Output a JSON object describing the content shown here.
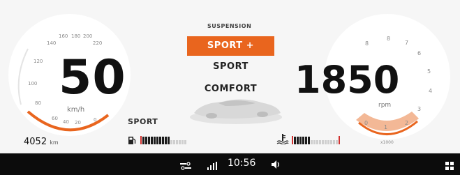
{
  "speedometer": {
    "value": "50",
    "unit": "km/h",
    "scale_top": [
      "160",
      "180",
      "200"
    ],
    "scale_top_small": [
      "140",
      "220"
    ],
    "scale_left": [
      "120",
      "100",
      "80"
    ],
    "scale_bottom": [
      "60",
      "40",
      "20",
      "0"
    ]
  },
  "odometer": {
    "value": "4052",
    "unit": "km"
  },
  "drive_mode": "SPORT",
  "suspension": {
    "title": "SUSPENSION",
    "options": [
      "SPORT +",
      "SPORT",
      "COMFORT"
    ],
    "selected_index": 0
  },
  "tachometer": {
    "value": "1850",
    "unit": "rpm",
    "scale_top": [
      "8",
      "8",
      "7"
    ],
    "scale_right": [
      "6",
      "5",
      "4",
      "3"
    ],
    "scale_bottom": [
      "0",
      "1",
      "2"
    ],
    "multiplier": "x1000"
  },
  "fuel": {
    "level": 0.6
  },
  "coolant": {
    "level": 0.4
  },
  "statusbar": {
    "time": "10:56"
  },
  "colors": {
    "accent": "#e9651e",
    "statusbar": "#0c0c0c"
  }
}
